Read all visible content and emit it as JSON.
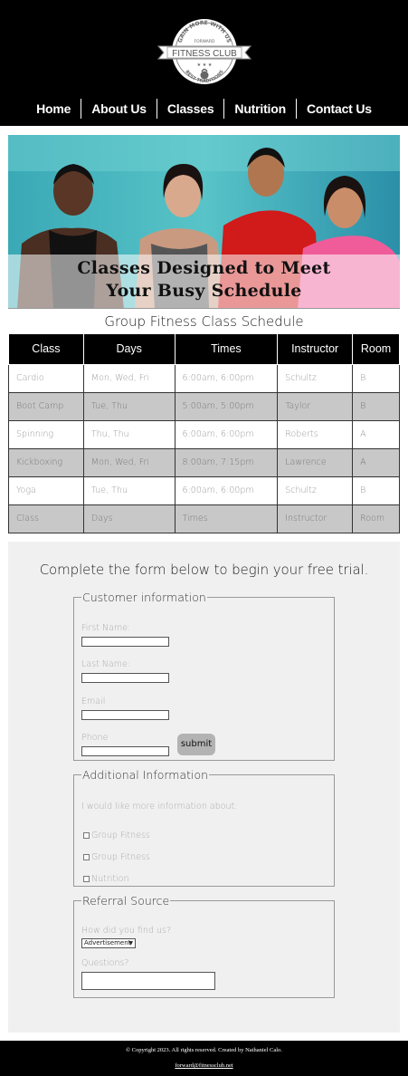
{
  "logo": {
    "top_text": "GAIN MORE WITH US",
    "brand_small": "FORWARD",
    "brand": "FITNESS CLUB",
    "bottom_text": "BEST TRADITIONS"
  },
  "nav": {
    "items": [
      "Home",
      "About Us",
      "Classes",
      "Nutrition",
      "Contact Us"
    ]
  },
  "hero": {
    "line1": "Classes Designed to Meet",
    "line2": "Your Busy Schedule"
  },
  "schedule": {
    "title": "Group Fitness Class Schedule",
    "headers": [
      "Class",
      "Days",
      "Times",
      "Instructor",
      "Room"
    ],
    "rows": [
      [
        "Cardio",
        "Mon, Wed, Fri",
        "6:00am, 6:00pm",
        "Schultz",
        "B"
      ],
      [
        "Boot Camp",
        "Tue, Thu",
        "5:00am, 5:00pm",
        "Taylor",
        "B"
      ],
      [
        "Spinning",
        "Thu, Thu",
        "6:00am, 6:00pm",
        "Roberts",
        "A"
      ],
      [
        "Kickboxing",
        "Mon, Wed, Fri",
        "8:00am, 7:15pm",
        "Lawrence",
        "A"
      ],
      [
        "Yoga",
        "Tue, Thu",
        "6:00am, 6:00pm",
        "Schultz",
        "B"
      ],
      [
        "Class",
        "Days",
        "Times",
        "Instructor",
        "Room"
      ]
    ]
  },
  "form": {
    "title": "Complete the form below to begin your free trial.",
    "customer": {
      "legend": "Customer information",
      "first_name": "First Name:",
      "last_name": "Last Name:",
      "email": "Email",
      "phone": "Phone"
    },
    "additional": {
      "legend": "Additional Information",
      "prompt": "I would like more information about:",
      "options": [
        "Group Fitness",
        "Group Fitness",
        "Nutrition"
      ]
    },
    "referral": {
      "legend": "Referral Source",
      "prompt": "How did you find us?",
      "select_value": "Advertisement",
      "questions": "Questions?"
    },
    "submit_label": "submit"
  },
  "footer": {
    "copyright": "© Copyright 2023. All rights reserved. Created by Nathaniel Calo.",
    "email": "forward@fitnessclub.net"
  },
  "colors": {
    "header_bg": "#000000",
    "table_alt_row": "#c8c8c8",
    "form_bg": "#f0f0f0"
  }
}
